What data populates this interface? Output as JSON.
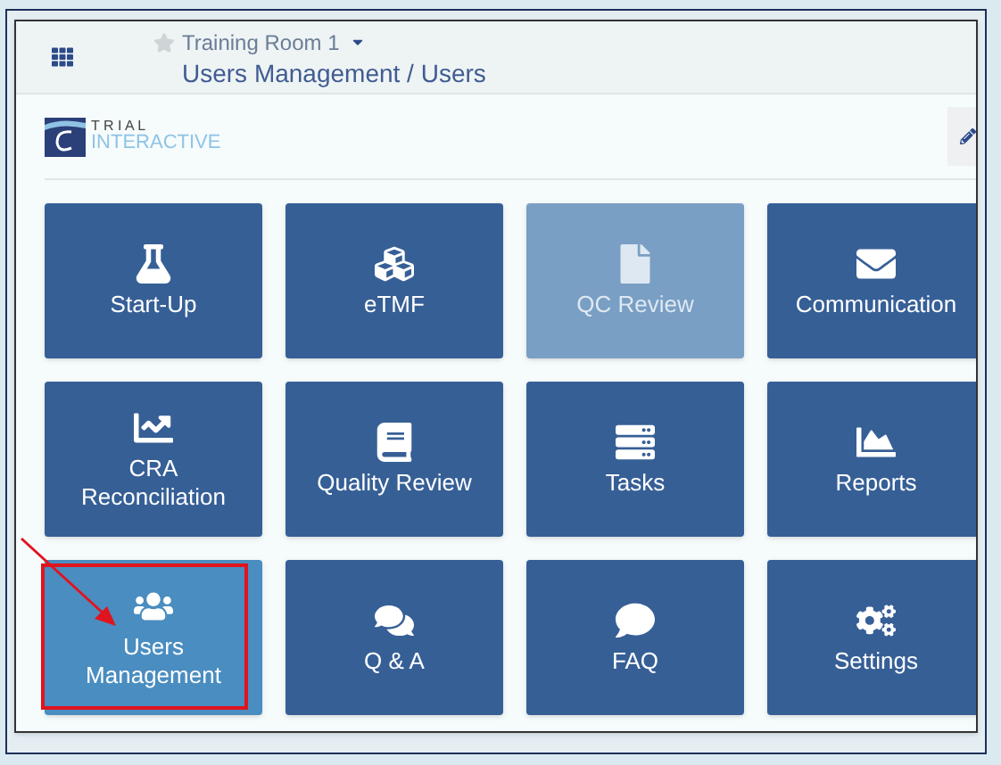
{
  "header": {
    "room": "Training Room 1",
    "breadcrumb": "Users Management / Users"
  },
  "logo": {
    "line_1": "T R I A L",
    "line_2": "INTERACTIVE"
  },
  "tiles": [
    {
      "label": "Start-Up",
      "selected": false,
      "disabled": false,
      "annotated": false
    },
    {
      "label": "eTMF",
      "selected": false,
      "disabled": false,
      "annotated": false
    },
    {
      "label": "QC Review",
      "selected": false,
      "disabled": true,
      "annotated": false
    },
    {
      "label": "Communication",
      "selected": false,
      "disabled": false,
      "annotated": false
    },
    {
      "label": "CRA Reconciliation",
      "selected": false,
      "disabled": false,
      "annotated": false
    },
    {
      "label": "Quality Review",
      "selected": false,
      "disabled": false,
      "annotated": false
    },
    {
      "label": "Tasks",
      "selected": false,
      "disabled": false,
      "annotated": false
    },
    {
      "label": "Reports",
      "selected": false,
      "disabled": false,
      "annotated": false
    },
    {
      "label": "Users Management",
      "selected": true,
      "disabled": false,
      "annotated": true
    },
    {
      "label": "Q & A",
      "selected": false,
      "disabled": false,
      "annotated": false
    },
    {
      "label": "FAQ",
      "selected": false,
      "disabled": false,
      "annotated": false
    },
    {
      "label": "Settings",
      "selected": false,
      "disabled": false,
      "annotated": false
    }
  ]
}
